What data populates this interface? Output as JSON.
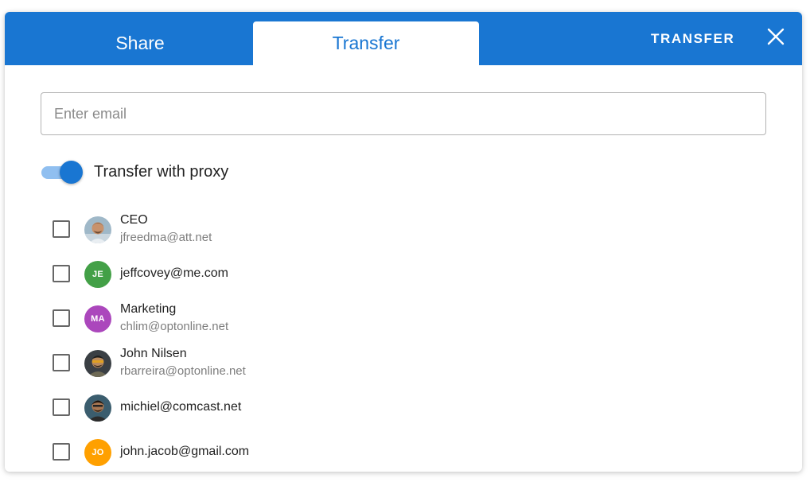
{
  "tabs": {
    "share": "Share",
    "transfer": "Transfer"
  },
  "header": {
    "action_label": "TRANSFER",
    "close_icon": "close-icon"
  },
  "email": {
    "placeholder": "Enter email",
    "value": ""
  },
  "proxy_toggle": {
    "label": "Transfer with proxy",
    "on": true
  },
  "colors": {
    "primary": "#1976d2",
    "toggle_track": "#90bff0"
  },
  "contacts": [
    {
      "name": "CEO",
      "email": "jfreedma@att.net",
      "avatar": "photo",
      "checked": false
    },
    {
      "name": "",
      "email": "jeffcovey@me.com",
      "avatar": "initials",
      "initials": "JE",
      "color": "#43a047",
      "checked": false
    },
    {
      "name": "Marketing",
      "email": "chlim@optonline.net",
      "avatar": "initials",
      "initials": "MA",
      "color": "#ab47bc",
      "checked": false
    },
    {
      "name": "John Nilsen",
      "email": "rbarreira@optonline.net",
      "avatar": "photo",
      "checked": false
    },
    {
      "name": "",
      "email": "michiel@comcast.net",
      "avatar": "photo",
      "checked": false
    },
    {
      "name": "",
      "email": "john.jacob@gmail.com",
      "avatar": "initials",
      "initials": "JO",
      "color": "#ffa000",
      "checked": false
    }
  ]
}
